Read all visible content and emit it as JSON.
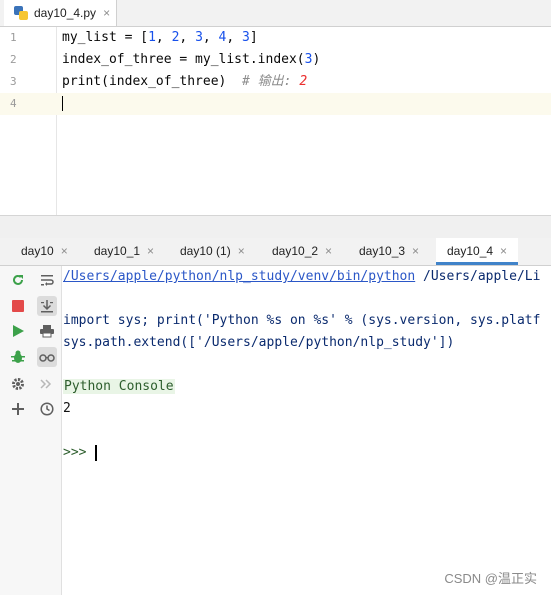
{
  "editor_tab": {
    "label": "day10_4.py",
    "close_glyph": "×"
  },
  "editor": {
    "line_numbers": [
      "1",
      "2",
      "3",
      "4"
    ],
    "lines": {
      "l1_a": "my_list = [",
      "l1_n1": "1",
      "l1_sep1": ", ",
      "l1_n2": "2",
      "l1_sep2": ", ",
      "l1_n3": "3",
      "l1_sep3": ", ",
      "l1_n4": "4",
      "l1_sep4": ", ",
      "l1_n5": "3",
      "l1_end": "]",
      "l2_a": "index_of_three = my_list.index(",
      "l2_n": "3",
      "l2_end": ")",
      "l3_code": "print(index_of_three)  ",
      "l3_comment": "# 输出: ",
      "l3_comment_num": "2"
    }
  },
  "console_tabs": [
    {
      "label": "day10",
      "close": "×"
    },
    {
      "label": "day10_1",
      "close": "×"
    },
    {
      "label": "day10 (1)",
      "close": "×"
    },
    {
      "label": "day10_2",
      "close": "×"
    },
    {
      "label": "day10_3",
      "close": "×"
    },
    {
      "label": "day10_4",
      "close": "×",
      "active": true
    }
  ],
  "console": {
    "interpreter_path": "/Users/apple/python/nlp_study/venv/bin/python",
    "interpreter_args": " /Users/apple/Li",
    "import_line": "import sys; print('Python %s on %s' % (sys.version, sys.platf",
    "path_line": "sys.path.extend(['/Users/apple/python/nlp_study'])",
    "banner": "Python Console",
    "result": "2",
    "prompt": ">>>"
  },
  "watermark": "CSDN @温正实",
  "colors": {
    "accent": "#4083c9",
    "number": "#1750eb",
    "comment_num": "#eb2f2f",
    "banner_bg": "#e9f5e6"
  }
}
